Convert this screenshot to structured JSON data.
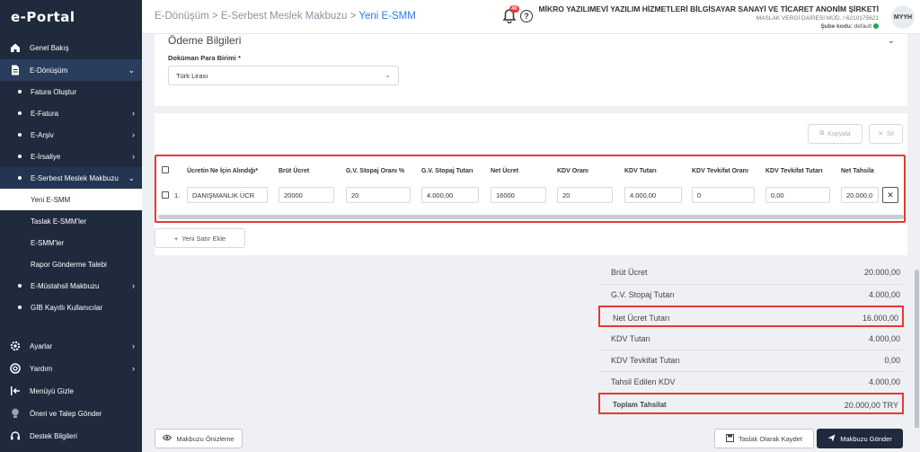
{
  "app": {
    "logo": "e-Portal"
  },
  "sidebar": {
    "items": [
      {
        "label": "Genel Bakış",
        "icon": "home-icon"
      },
      {
        "label": "E-Dönüşüm",
        "icon": "document-icon"
      },
      {
        "label": "Fatura Oluştur"
      },
      {
        "label": "E-Fatura"
      },
      {
        "label": "E-Arşiv"
      },
      {
        "label": "E-İrsaliye"
      },
      {
        "label": "E-Serbest Meslek Makbuzu"
      },
      {
        "label": "Yeni E-SMM"
      },
      {
        "label": "Taslak E-SMM'ler"
      },
      {
        "label": "E-SMM'ler"
      },
      {
        "label": "Rapor Gönderme Talebi"
      },
      {
        "label": "E-Müstahsil Makbuzu"
      },
      {
        "label": "GİB Kayıtlı Kullanıcılar"
      },
      {
        "label": "Ayarlar",
        "icon": "gear-icon"
      },
      {
        "label": "Yardım",
        "icon": "lifebuoy-icon"
      },
      {
        "label": "Menüyü Gizle",
        "icon": "collapse-menu-icon"
      },
      {
        "label": "Öneri ve Talep Gönder",
        "icon": "lightbulb-icon"
      },
      {
        "label": "Destek Bilgileri",
        "icon": "headset-icon"
      }
    ]
  },
  "header": {
    "breadcrumb": [
      "E-Dönüşüm",
      "E-Serbest Meslek Makbuzu",
      "Yeni E-SMM"
    ],
    "notification_count": "40",
    "company_name": "MİKRO YAZILIMEVİ YAZILIM HİZMETLERİ BİLGİSAYAR SANAYİ VE TİCARET ANONİM ŞİRKETİ",
    "tax_info": "MASLAK VERGİ DAİRESİ MÜD. / 6210175621",
    "branch_label": "Şube kodu:",
    "branch_value": "default",
    "avatar": "MYYH"
  },
  "payment": {
    "title": "Ödeme Bilgileri",
    "currency_label": "Doküman Para Birimi *",
    "currency_value": "Türk Lirası"
  },
  "toolbar": {
    "copy_label": "Kopyala",
    "delete_label": "Sil"
  },
  "table": {
    "headers": [
      "Ücretin Ne İçin Alındığı*",
      "Brüt Ücret",
      "G.V. Stopaj Oranı %",
      "G.V. Stopaj Tutarı",
      "Net Ücret",
      "KDV Oranı",
      "KDV Tutarı",
      "KDV Tevkifat Oranı",
      "KDV Tevkifat Tutarı",
      "Net Tahsila"
    ],
    "row": {
      "index": "1.",
      "cells": [
        "DANIŞMANLIK ÜCR",
        "20000",
        "20",
        "4.000,00",
        "16000",
        "20",
        "4.000,00",
        "0",
        "0,00",
        "20.000,0"
      ]
    },
    "add_row_label": "Yeni Satır Ekle"
  },
  "summary": [
    {
      "label": "Brüt Ücret",
      "value": "20.000,00"
    },
    {
      "label": "G.V. Stopaj Tutarı",
      "value": "4.000,00"
    },
    {
      "label": "Net Ücret Tutarı",
      "value": "16.000,00"
    },
    {
      "label": "KDV Tutarı",
      "value": "4.000,00"
    },
    {
      "label": "KDV Tevkifat Tutarı",
      "value": "0,00"
    },
    {
      "label": "Tahsil Edilen KDV",
      "value": "4.000,00"
    },
    {
      "label": "Toplam Tahsilat",
      "value": "20.000,00 TRY"
    }
  ],
  "footer": {
    "preview_label": "Makbuzu Önizleme",
    "save_draft_label": "Taslak Olarak Kaydet",
    "send_label": "Makbuzu Gönder"
  },
  "colors": {
    "sidebar": "#1f2a3c",
    "accent": "#2d7be5",
    "highlight": "#e53935"
  }
}
